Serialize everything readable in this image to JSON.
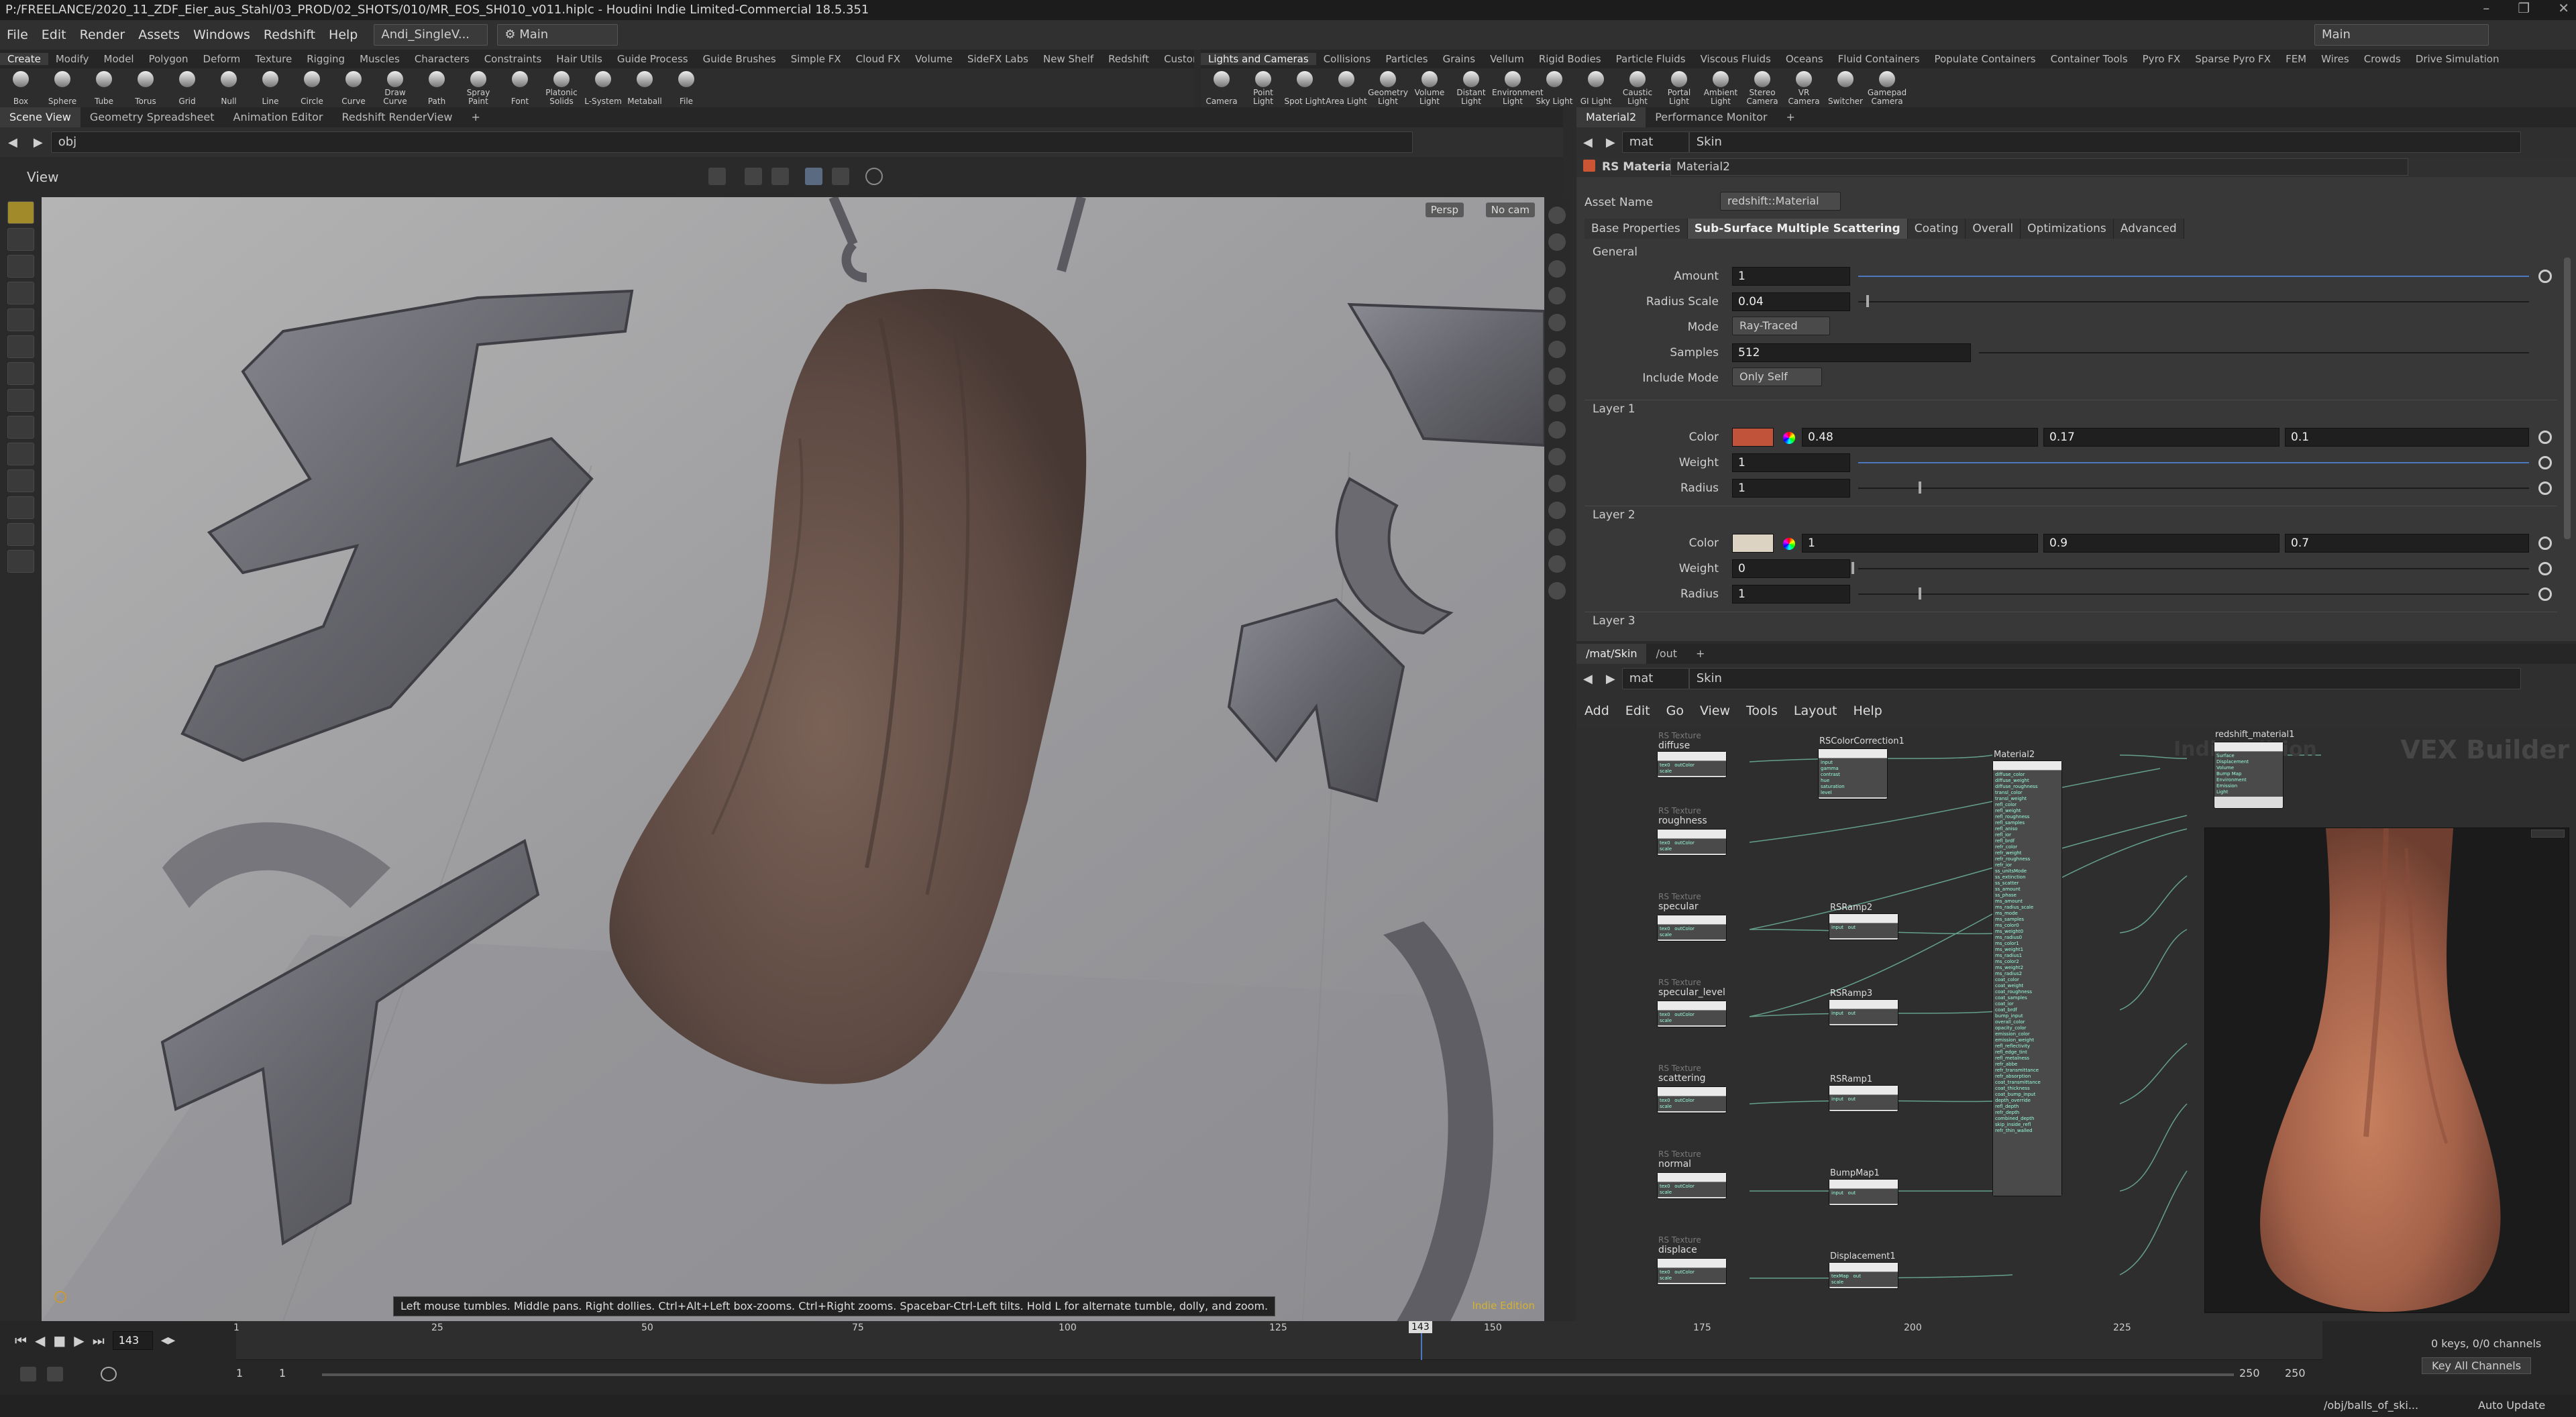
{
  "window": {
    "title": "P:/FREELANCE/2020_11_ZDF_Eier_aus_Stahl/03_PROD/02_SHOTS/010/MR_EOS_SH010_v011.hiplc - Houdini Indie Limited-Commercial 18.5.351"
  },
  "menubar": {
    "items": [
      "File",
      "Edit",
      "Render",
      "Assets",
      "Windows",
      "Redshift",
      "Help"
    ],
    "desktop": "Andi_SingleV...",
    "main": "Main",
    "main_right": "Main"
  },
  "shelf_left": {
    "tabs": [
      "Create",
      "Modify",
      "Model",
      "Polygon",
      "Deform",
      "Texture",
      "Rigging",
      "Muscles",
      "Characters",
      "Constraints",
      "Hair Utils",
      "Guide Process",
      "Guide Brushes",
      "Simple FX",
      "Cloud FX",
      "Volume",
      "SideFX Labs",
      "New Shelf",
      "Redshift",
      "Custom Tools"
    ],
    "tools": [
      "Box",
      "Sphere",
      "Tube",
      "Torus",
      "Grid",
      "Null",
      "Line",
      "Circle",
      "Curve",
      "Draw Curve",
      "Path",
      "Spray Paint",
      "Font",
      "Platonic Solids",
      "L-System",
      "Metaball",
      "File"
    ]
  },
  "shelf_right": {
    "tabs": [
      "Lights and Cameras",
      "Collisions",
      "Particles",
      "Grains",
      "Vellum",
      "Rigid Bodies",
      "Particle Fluids",
      "Viscous Fluids",
      "Oceans",
      "Fluid Containers",
      "Populate Containers",
      "Container Tools",
      "Pyro FX",
      "Sparse Pyro FX",
      "FEM",
      "Wires",
      "Crowds",
      "Drive Simulation"
    ],
    "tools": [
      "Camera",
      "Point Light",
      "Spot Light",
      "Area Light",
      "Geometry Light",
      "Volume Light",
      "Distant Light",
      "Environment Light",
      "Sky Light",
      "GI Light",
      "Caustic Light",
      "Portal Light",
      "Ambient Light",
      "Stereo Camera",
      "VR Camera",
      "Switcher",
      "Gamepad Camera"
    ]
  },
  "left_pane": {
    "tabs": [
      "Scene View",
      "Geometry Spreadsheet",
      "Animation Editor",
      "Redshift RenderView"
    ],
    "path": "obj",
    "view_label": "View",
    "persp": "Persp",
    "camera": "No cam",
    "edition": "Indie Edition",
    "status_hint": "Left mouse tumbles. Middle pans. Right dollies. Ctrl+Alt+Left box-zooms. Ctrl+Right zooms. Spacebar-Ctrl-Left tilts. Hold L for alternate tumble, dolly, and zoom."
  },
  "param_pane": {
    "tabs": [
      "Material2",
      "Performance Monitor"
    ],
    "path_ctx": "mat",
    "path_node": "Skin",
    "node_type": "RS Material",
    "node_name": "Material2",
    "asset_name_label": "Asset Name",
    "asset_name": "redshift::Material",
    "subtabs": [
      "Base Properties",
      "Sub-Surface Multiple Scattering",
      "Coating",
      "Overall",
      "Optimizations",
      "Advanced"
    ],
    "general_label": "General",
    "amount_label": "Amount",
    "amount": "1",
    "radius_scale_label": "Radius Scale",
    "radius_scale": "0.04",
    "mode_label": "Mode",
    "mode": "Ray-Traced",
    "samples_label": "Samples",
    "samples": "512",
    "include_mode_label": "Include Mode",
    "include_mode": "Only Self",
    "layer1": {
      "label": "Layer 1",
      "color_label": "Color",
      "r": "0.48",
      "g": "0.17",
      "b": "0.1",
      "weight_label": "Weight",
      "weight": "1",
      "radius_label": "Radius",
      "radius": "1",
      "swatch": "#c0533a"
    },
    "layer2": {
      "label": "Layer 2",
      "color_label": "Color",
      "r": "1",
      "g": "0.9",
      "b": "0.7",
      "weight_label": "Weight",
      "weight": "0",
      "radius_label": "Radius",
      "radius": "1",
      "swatch": "#ddd3c3"
    },
    "layer3": {
      "label": "Layer 3"
    }
  },
  "network": {
    "tabs": [
      "/mat/Skin",
      "/out"
    ],
    "path_ctx": "mat",
    "path_node": "Skin",
    "menu": [
      "Add",
      "Edit",
      "Go",
      "View",
      "Tools",
      "Layout",
      "Help"
    ],
    "watermark": "Indie Edition",
    "builder": "VEX Builder",
    "textures": [
      {
        "type": "RS Texture",
        "name": "diffuse"
      },
      {
        "type": "RS Texture",
        "name": "roughness"
      },
      {
        "type": "RS Texture",
        "name": "specular"
      },
      {
        "type": "RS Texture",
        "name": "specular_level"
      },
      {
        "type": "RS Texture",
        "name": "scattering"
      },
      {
        "type": "RS Texture",
        "name": "normal"
      },
      {
        "type": "RS Texture",
        "name": "displace"
      }
    ],
    "mids": [
      "RSColorCorrection1",
      "RSRamp2",
      "RSRamp3",
      "RSRamp1",
      "BumpMap1",
      "Displacement1"
    ],
    "material": "Material2",
    "output": "redshift_material1"
  },
  "timeline": {
    "frame": "143",
    "ticks": [
      "1",
      "25",
      "50",
      "75",
      "100",
      "125",
      "150",
      "175",
      "200",
      "225"
    ],
    "marker": "143",
    "start": "1",
    "start2": "1",
    "end": "250",
    "end2": "250",
    "keys": "0 keys, 0/0 channels",
    "key_all": "Key All Channels",
    "status_path": "/obj/balls_of_ski...",
    "auto_update": "Auto Update"
  }
}
